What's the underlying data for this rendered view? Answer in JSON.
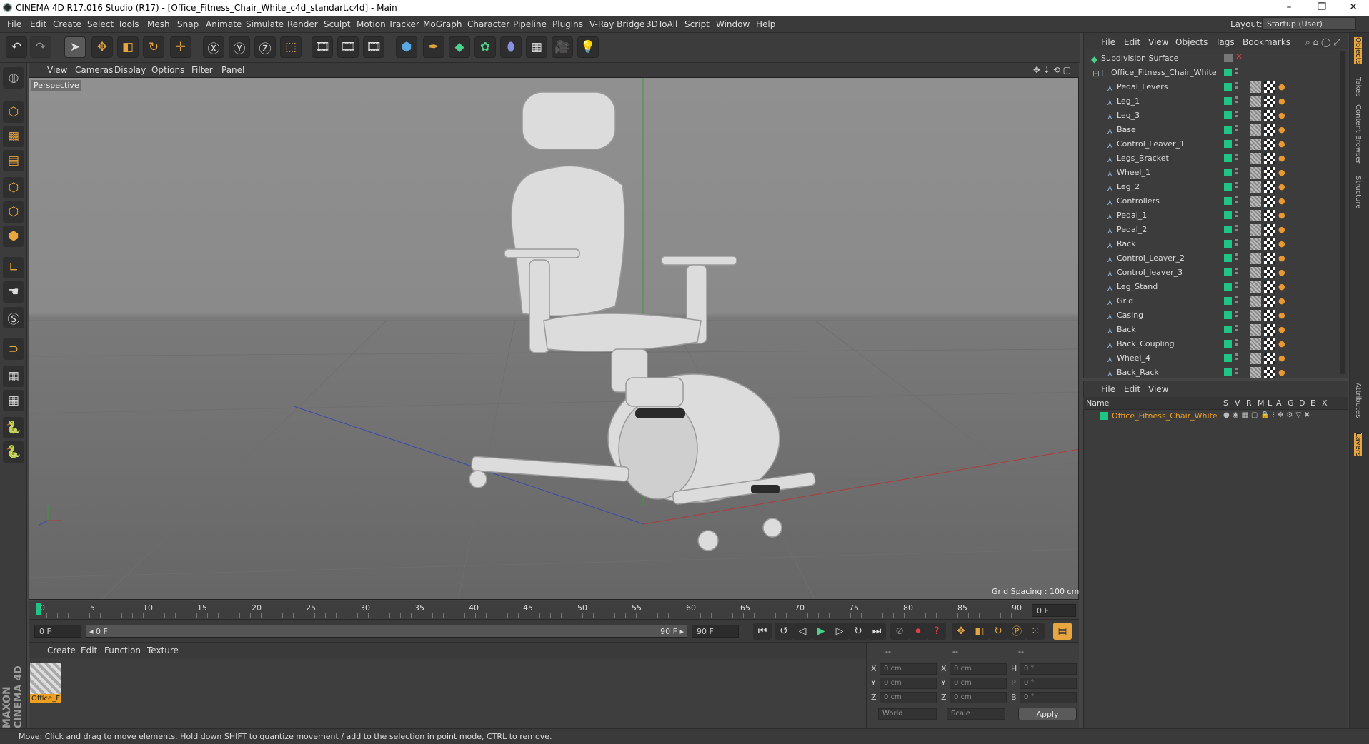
{
  "window": {
    "title": "CINEMA 4D R17.016 Studio (R17) - [Office_Fitness_Chair_White_c4d_standart.c4d] - Main",
    "minimize": "–",
    "restore": "❐",
    "close": "✕"
  },
  "menubar": {
    "items": [
      "File",
      "Edit",
      "Create",
      "Select",
      "Tools",
      "Mesh",
      "Snap",
      "Animate",
      "Simulate",
      "Render",
      "Sculpt",
      "Motion Tracker",
      "MoGraph",
      "Character",
      "Pipeline",
      "Plugins",
      "V-Ray Bridge",
      "3DToAll",
      "Script",
      "Window",
      "Help"
    ],
    "layout_label": "Layout:",
    "layout_value": "Startup (User)"
  },
  "viewport": {
    "menu": [
      "View",
      "Cameras",
      "Display",
      "Options",
      "Filter",
      "Panel"
    ],
    "label": "Perspective",
    "grid_spacing": "Grid Spacing : 100 cm"
  },
  "timeline": {
    "ticks": [
      "0",
      "5",
      "10",
      "15",
      "20",
      "25",
      "30",
      "35",
      "40",
      "45",
      "50",
      "55",
      "60",
      "65",
      "70",
      "75",
      "80",
      "85",
      "90"
    ],
    "frame_end_field": "0 F",
    "start_field": "0 F",
    "range_start": "◂ 0 F",
    "range_end": "90 F ▸",
    "end_field": "90 F"
  },
  "material_panel": {
    "menu": [
      "Create",
      "Edit",
      "Function",
      "Texture"
    ],
    "material_name": "Office_F"
  },
  "coords": {
    "rows": [
      {
        "a": "X",
        "av": "0 cm",
        "b": "X",
        "bv": "0 cm",
        "c": "H",
        "cv": "0 °"
      },
      {
        "a": "Y",
        "av": "0 cm",
        "b": "Y",
        "bv": "0 cm",
        "c": "P",
        "cv": "0 °"
      },
      {
        "a": "Z",
        "av": "0 cm",
        "b": "Z",
        "bv": "0 cm",
        "c": "B",
        "cv": "0 °"
      }
    ],
    "header": [
      "--",
      "--",
      "--"
    ],
    "world": "World",
    "scale": "Scale",
    "apply": "Apply"
  },
  "objects_panel": {
    "menu": [
      "File",
      "Edit",
      "View",
      "Objects",
      "Tags",
      "Bookmarks"
    ],
    "root": "Subdivision Surface",
    "group": "Office_Fitness_Chair_White",
    "children": [
      "Pedal_Levers",
      "Leg_1",
      "Leg_3",
      "Base",
      "Control_Leaver_1",
      "Legs_Bracket",
      "Wheel_1",
      "Leg_2",
      "Controllers",
      "Pedal_1",
      "Pedal_2",
      "Rack",
      "Control_Leaver_2",
      "Control_leaver_3",
      "Leg_Stand",
      "Grid",
      "Casing",
      "Back",
      "Back_Coupling",
      "Wheel_4",
      "Back_Rack"
    ]
  },
  "layers_panel": {
    "menu": [
      "File",
      "Edit",
      "View"
    ],
    "columns": [
      "Name",
      "S",
      "V",
      "R",
      "M",
      "L",
      "A",
      "G",
      "D",
      "E",
      "X"
    ],
    "row_name": "Office_Fitness_Chair_White"
  },
  "right_tabs": [
    "Objects",
    "Takes",
    "Content Browser",
    "Structure",
    "Attributes",
    "Layers"
  ],
  "status": "Move: Click and drag to move elements. Hold down SHIFT to quantize movement / add to the selection in point mode, CTRL to remove.",
  "brand": "MAXON CINEMA 4D",
  "colors": {
    "accent": "#e8a640",
    "green": "#1fc586",
    "selection": "#f0a020"
  }
}
